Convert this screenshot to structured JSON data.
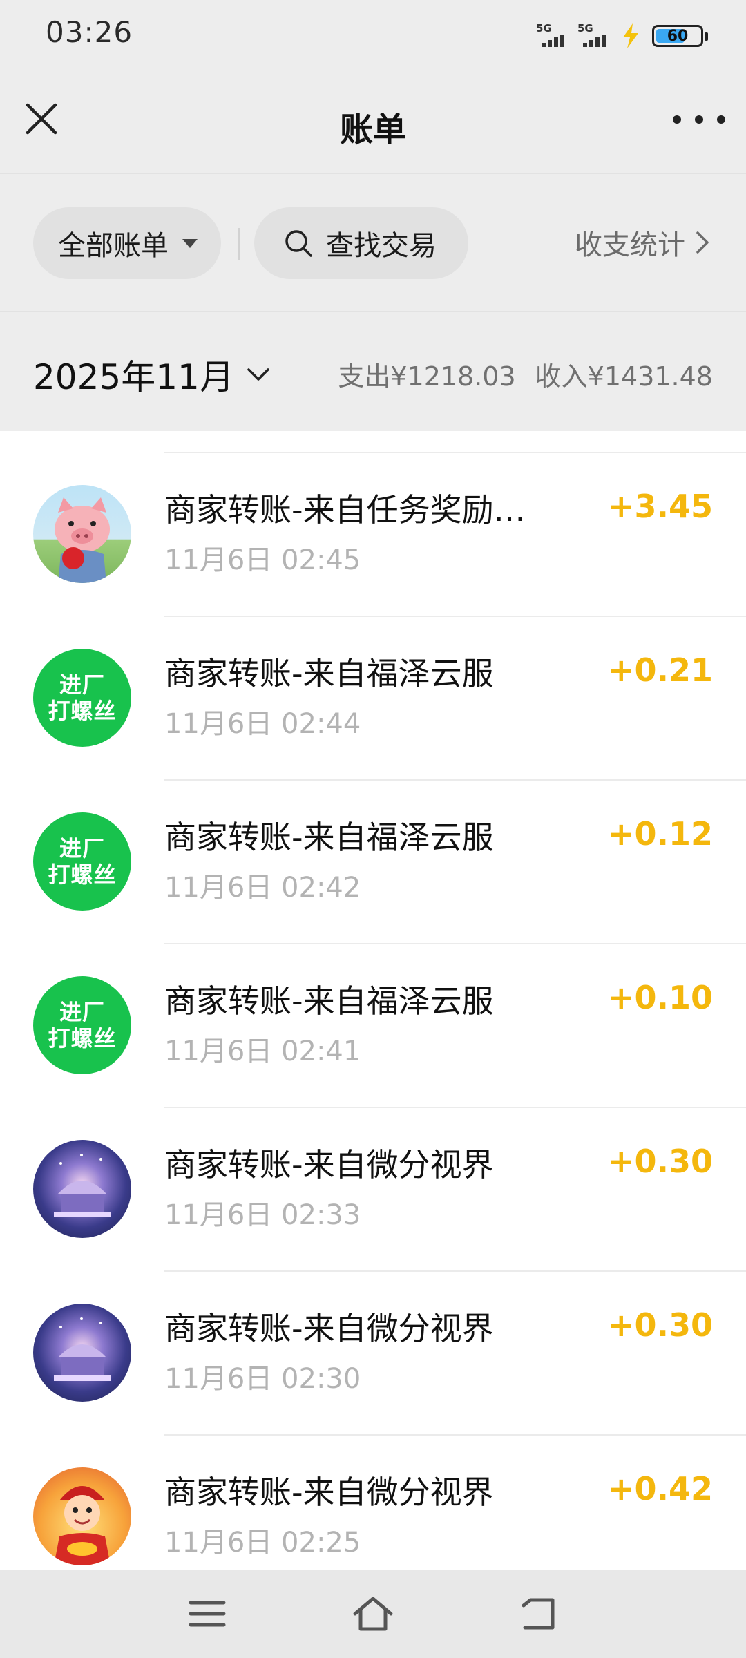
{
  "status_bar": {
    "time": "03:26",
    "signal_1": "5G",
    "signal_2": "5G",
    "battery": "60"
  },
  "nav": {
    "title": "账单"
  },
  "filters": {
    "all_bills": "全部账单",
    "search": "查找交易",
    "stats": "收支统计"
  },
  "month": {
    "label": "2025年11月",
    "expense": "支出¥1218.03",
    "income": "收入¥1431.48"
  },
  "transactions": [
    {
      "title": "商家转账-来自任务奖励…",
      "time": "11月6日 02:45",
      "amount": "+3.45",
      "avatar": "pig-avatar"
    },
    {
      "title": "商家转账-来自福泽云服",
      "time": "11月6日 02:44",
      "amount": "+0.21",
      "avatar": "green-text-avatar",
      "avatar_text": [
        "进厂",
        "打螺丝"
      ]
    },
    {
      "title": "商家转账-来自福泽云服",
      "time": "11月6日 02:42",
      "amount": "+0.12",
      "avatar": "green-text-avatar",
      "avatar_text": [
        "进厂",
        "打螺丝"
      ]
    },
    {
      "title": "商家转账-来自福泽云服",
      "time": "11月6日 02:41",
      "amount": "+0.10",
      "avatar": "green-text-avatar",
      "avatar_text": [
        "进厂",
        "打螺丝"
      ]
    },
    {
      "title": "商家转账-来自微分视界",
      "time": "11月6日 02:33",
      "amount": "+0.30",
      "avatar": "carousel-avatar"
    },
    {
      "title": "商家转账-来自微分视界",
      "time": "11月6日 02:30",
      "amount": "+0.30",
      "avatar": "carousel-avatar"
    },
    {
      "title": "商家转账-来自微分视界",
      "time": "11月6日 02:25",
      "amount": "+0.42",
      "avatar": "fortune-god-avatar"
    }
  ],
  "colors": {
    "amount": "#f4b70d",
    "green_avatar": "#18c24d",
    "background": "#ededed"
  }
}
